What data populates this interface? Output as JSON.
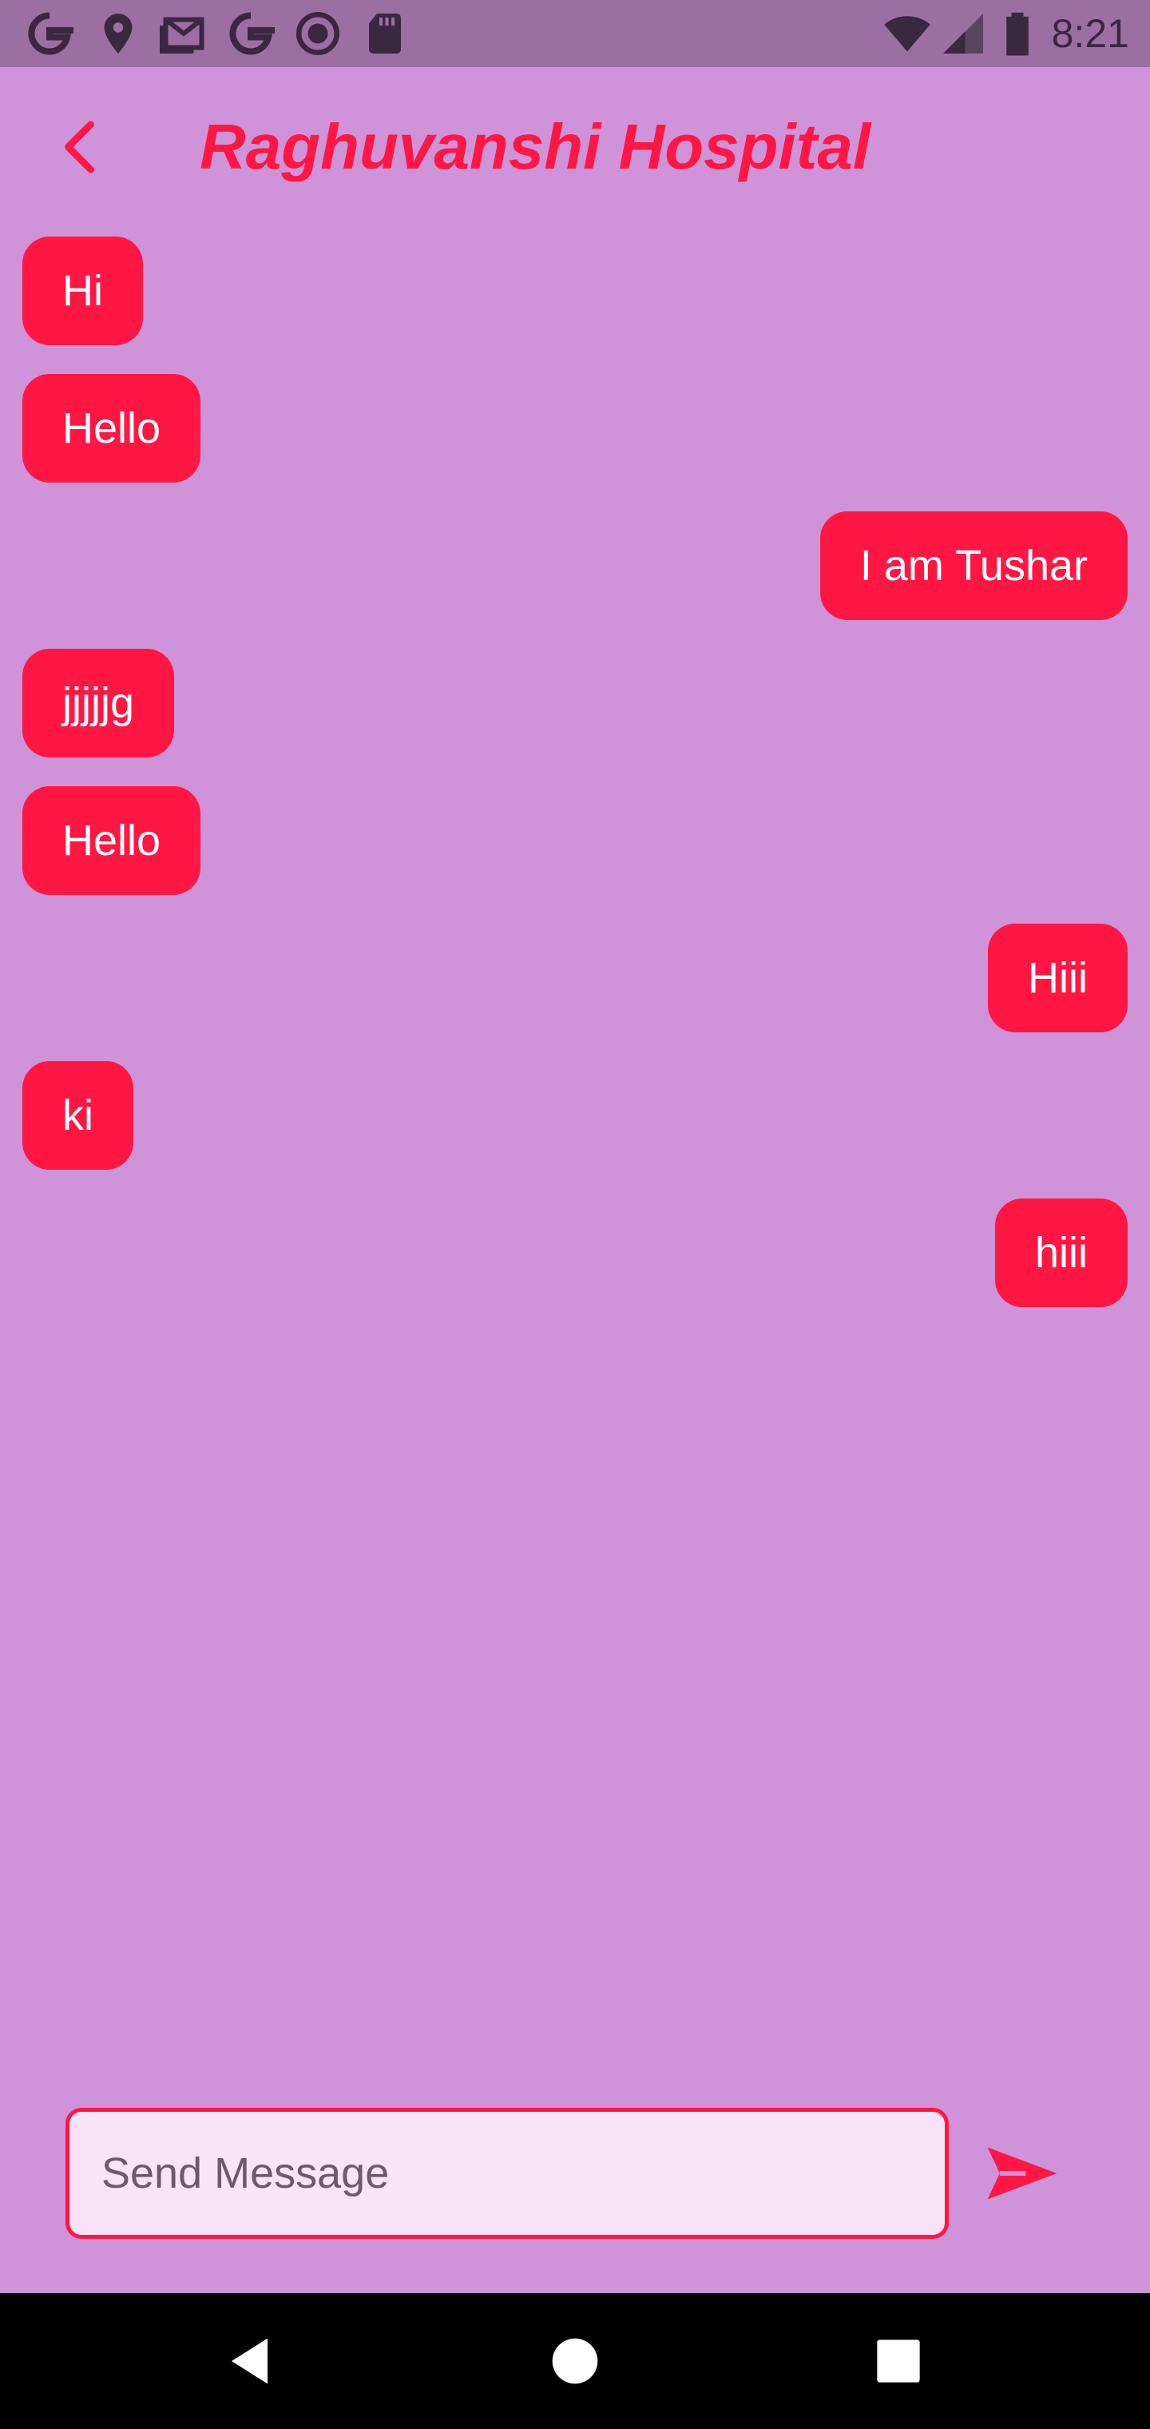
{
  "status_bar": {
    "time": "8:21",
    "notification_icons": [
      "google-icon",
      "location-icon",
      "gmail-icon",
      "google-icon",
      "record-icon",
      "sd-card-icon"
    ],
    "system_icons": [
      "wifi-icon",
      "signal-icon",
      "battery-icon"
    ]
  },
  "app_bar": {
    "title": "Raghuvanshi Hospital",
    "back_icon": "back-arrow-icon"
  },
  "messages": [
    {
      "text": "Hi",
      "direction": "received"
    },
    {
      "text": "Hello",
      "direction": "received"
    },
    {
      "text": "I am Tushar",
      "direction": "sent"
    },
    {
      "text": "jjjjjg",
      "direction": "received"
    },
    {
      "text": "Hello",
      "direction": "received"
    },
    {
      "text": "Hiii",
      "direction": "sent"
    },
    {
      "text": "ki",
      "direction": "received"
    },
    {
      "text": "hiii",
      "direction": "sent"
    }
  ],
  "composer": {
    "placeholder": "Send Message",
    "value": "",
    "send_icon": "send-icon"
  },
  "nav_bar": {
    "buttons": [
      "back-triangle-icon",
      "home-circle-icon",
      "recents-square-icon"
    ]
  },
  "colors": {
    "background": "#CE93D8",
    "status_bar": "#9C6FA3",
    "accent": "#FF1744",
    "input_background": "#F8E3F9",
    "bubble_text": "#FFFFFF",
    "nav_bar": "#000000"
  }
}
